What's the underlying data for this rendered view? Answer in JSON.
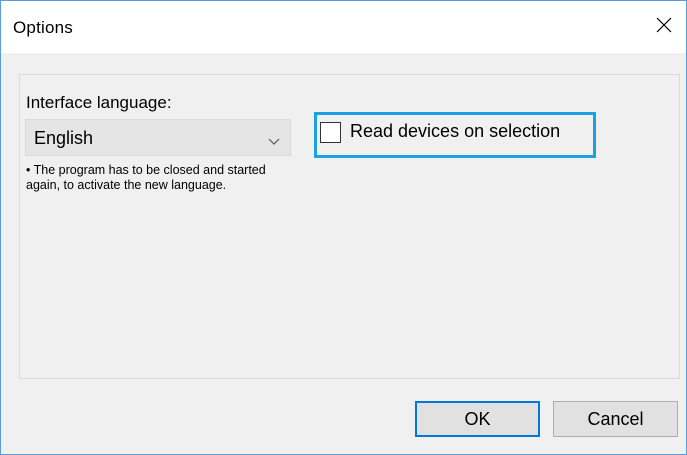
{
  "window": {
    "title": "Options",
    "close_icon": "close-icon"
  },
  "language": {
    "label": "Interface language:",
    "selected": "English",
    "note": "• The program has to be closed and started again, to activate the new language."
  },
  "read_devices": {
    "label": "Read devices on selection",
    "checked": false
  },
  "buttons": {
    "ok_label": "OK",
    "cancel_label": "Cancel"
  },
  "colors": {
    "focus_outline": "#1ba1e2",
    "default_button_border": "#0078d7",
    "window_border": "#5b9bd5"
  }
}
